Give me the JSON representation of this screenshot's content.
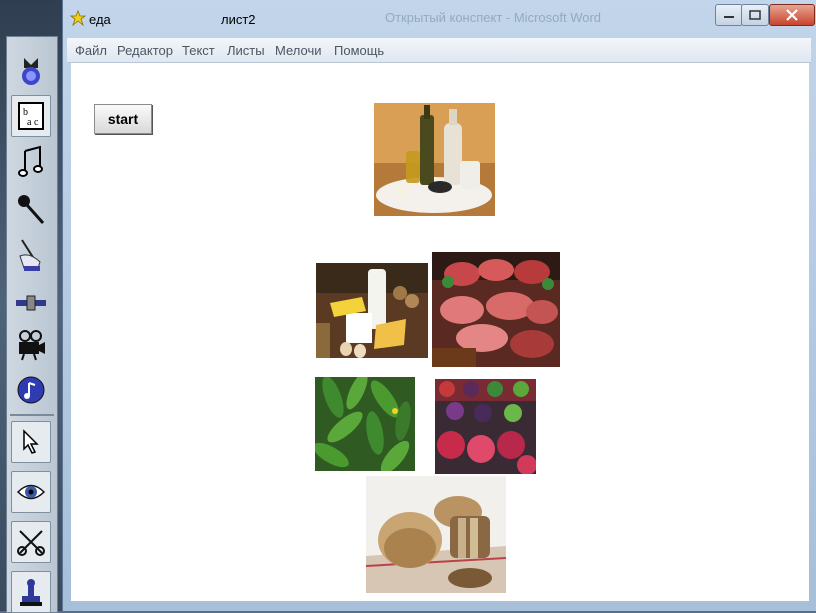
{
  "window": {
    "doc_title": "еда",
    "sheet_title": "лист2",
    "faded_title": "Открытый конспект - Microsoft Word"
  },
  "menu": [
    "Файл",
    "Редактор",
    "Текст",
    "Листы",
    "Мелочи",
    "Помощь"
  ],
  "start_button": "start",
  "palette_tools": [
    "sprite-tool",
    "text-tool",
    "music-tool",
    "microphone-tool",
    "paint-tool",
    "slider-tool",
    "video-tool",
    "sound-tool",
    "pointer-tool",
    "eye-tool",
    "scissors-tool",
    "stamp-tool"
  ],
  "images": [
    "oils-and-fats",
    "dairy-products",
    "meat-products",
    "cucumbers",
    "fruits",
    "bread"
  ],
  "colors": {
    "canvas": "#ffffff",
    "frame": "#b0c6de",
    "close": "#c8442d"
  }
}
